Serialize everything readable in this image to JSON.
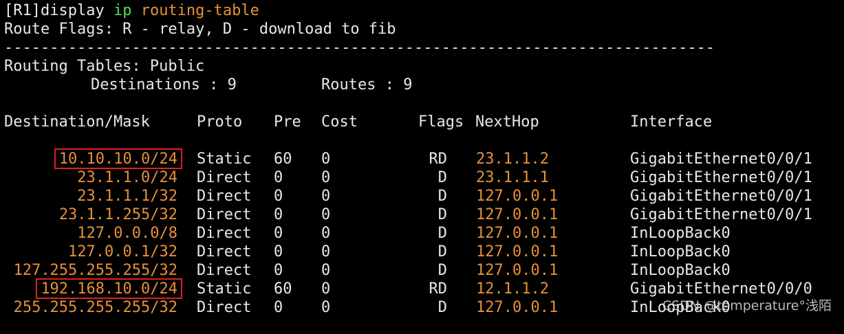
{
  "terminal": {
    "prompt": "[R1]display ",
    "cmd_ip": "ip",
    "cmd_rt": "routing-table",
    "flags_line": "Route Flags: R - relay, D - download to fib",
    "separator": "------------------------------------------------------------------------------",
    "tables_line": "Routing Tables: Public",
    "dest_label": "Destinations : 9",
    "routes_label": "Routes : 9",
    "headers": {
      "dest": "Destination/Mask",
      "proto": "Proto",
      "pre": "Pre",
      "cost": "Cost",
      "flags": "Flags",
      "nexthop": "NextHop",
      "iface": "Interface"
    },
    "rows": [
      {
        "dest": "10.10.10.0/24",
        "proto": "Static",
        "pre": "60",
        "cost": "0",
        "flags": "RD",
        "nexthop": "23.1.1.2",
        "iface": "GigabitEthernet0/0/1"
      },
      {
        "dest": "23.1.1.0/24",
        "proto": "Direct",
        "pre": "0",
        "cost": "0",
        "flags": "D",
        "nexthop": "23.1.1.1",
        "iface": "GigabitEthernet0/0/1"
      },
      {
        "dest": "23.1.1.1/32",
        "proto": "Direct",
        "pre": "0",
        "cost": "0",
        "flags": "D",
        "nexthop": "127.0.0.1",
        "iface": "GigabitEthernet0/0/1"
      },
      {
        "dest": "23.1.1.255/32",
        "proto": "Direct",
        "pre": "0",
        "cost": "0",
        "flags": "D",
        "nexthop": "127.0.0.1",
        "iface": "GigabitEthernet0/0/1"
      },
      {
        "dest": "127.0.0.0/8",
        "proto": "Direct",
        "pre": "0",
        "cost": "0",
        "flags": "D",
        "nexthop": "127.0.0.1",
        "iface": "InLoopBack0"
      },
      {
        "dest": "127.0.0.1/32",
        "proto": "Direct",
        "pre": "0",
        "cost": "0",
        "flags": "D",
        "nexthop": "127.0.0.1",
        "iface": "InLoopBack0"
      },
      {
        "dest": "127.255.255.255/32",
        "proto": "Direct",
        "pre": "0",
        "cost": "0",
        "flags": "D",
        "nexthop": "127.0.0.1",
        "iface": "InLoopBack0"
      },
      {
        "dest": "192.168.10.0/24",
        "proto": "Static",
        "pre": "60",
        "cost": "0",
        "flags": "RD",
        "nexthop": "12.1.1.2",
        "iface": "GigabitEthernet0/0/0"
      },
      {
        "dest": "255.255.255.255/32",
        "proto": "Direct",
        "pre": "0",
        "cost": "0",
        "flags": "D",
        "nexthop": "127.0.0.1",
        "iface": "InLoopBack0"
      }
    ],
    "highlighted_rows": [
      0,
      7
    ]
  },
  "watermark": "CSDN @temperature°浅陌",
  "colors": {
    "background": "#000000",
    "text": "#e8e8e8",
    "ip_keyword": "#55dd55",
    "address": "#e69138",
    "highlight_box": "#e02020"
  }
}
